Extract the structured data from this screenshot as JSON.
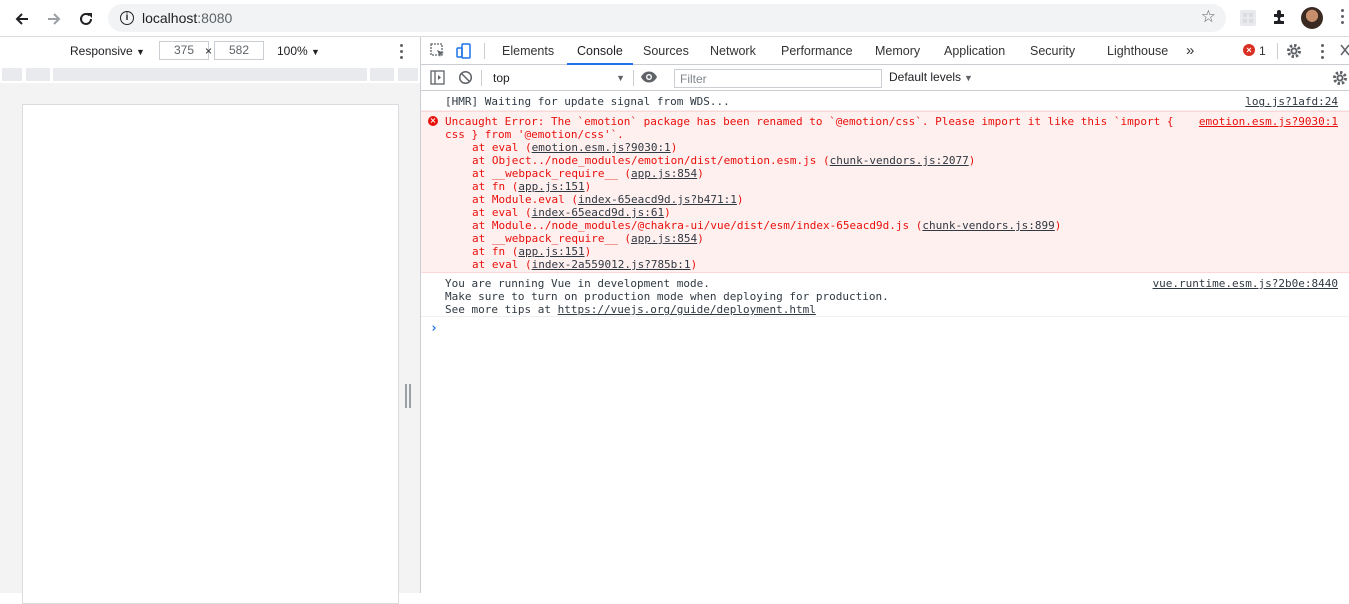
{
  "browser": {
    "url_host": "localhost",
    "url_port": ":8080"
  },
  "device_toolbar": {
    "preset": "Responsive",
    "width": "375",
    "times": "×",
    "height": "582",
    "zoom": "100%"
  },
  "devtools": {
    "tabs": [
      "Elements",
      "Console",
      "Sources",
      "Network",
      "Performance",
      "Memory",
      "Application",
      "Security",
      "Lighthouse"
    ],
    "active_tab": "Console",
    "more_tabs": "»",
    "error_count": "1",
    "error_badge": "×"
  },
  "console_toolbar": {
    "context": "top",
    "filter_placeholder": "Filter",
    "levels": "Default levels"
  },
  "console": {
    "hmr": {
      "text": "[HMR] Waiting for update signal from WDS...",
      "source": "log.js?1afd:24"
    },
    "error": {
      "line1": "Uncaught Error: The `emotion` package has been renamed to `@emotion/css`. Please import it like this `import {",
      "line2": "css } from '@emotion/css'`.",
      "source": "emotion.esm.js?9030:1",
      "stack": [
        {
          "pre": "at eval (",
          "link": "emotion.esm.js?9030:1",
          "post": ")"
        },
        {
          "pre": "at Object../node_modules/emotion/dist/emotion.esm.js (",
          "link": "chunk-vendors.js:2077",
          "post": ")"
        },
        {
          "pre": "at __webpack_require__ (",
          "link": "app.js:854",
          "post": ")"
        },
        {
          "pre": "at fn (",
          "link": "app.js:151",
          "post": ")"
        },
        {
          "pre": "at Module.eval (",
          "link": "index-65eacd9d.js?b471:1",
          "post": ")"
        },
        {
          "pre": "at eval (",
          "link": "index-65eacd9d.js:61",
          "post": ")"
        },
        {
          "pre": "at Module../node_modules/@chakra-ui/vue/dist/esm/index-65eacd9d.js (",
          "link": "chunk-vendors.js:899",
          "post": ")"
        },
        {
          "pre": "at __webpack_require__ (",
          "link": "app.js:854",
          "post": ")"
        },
        {
          "pre": "at fn (",
          "link": "app.js:151",
          "post": ")"
        },
        {
          "pre": "at eval (",
          "link": "index-2a559012.js?785b:1",
          "post": ")"
        }
      ]
    },
    "vue": {
      "line1": "You are running Vue in development mode.",
      "line2": "Make sure to turn on production mode when deploying for production.",
      "line3_pre": "See more tips at ",
      "line3_link": "https://vuejs.org/guide/deployment.html",
      "source": "vue.runtime.esm.js?2b0e:8440"
    },
    "prompt": "›"
  },
  "colors": {
    "accent": "#1a73e8",
    "error": "#e8100b",
    "error_bg": "#fff0f0"
  }
}
